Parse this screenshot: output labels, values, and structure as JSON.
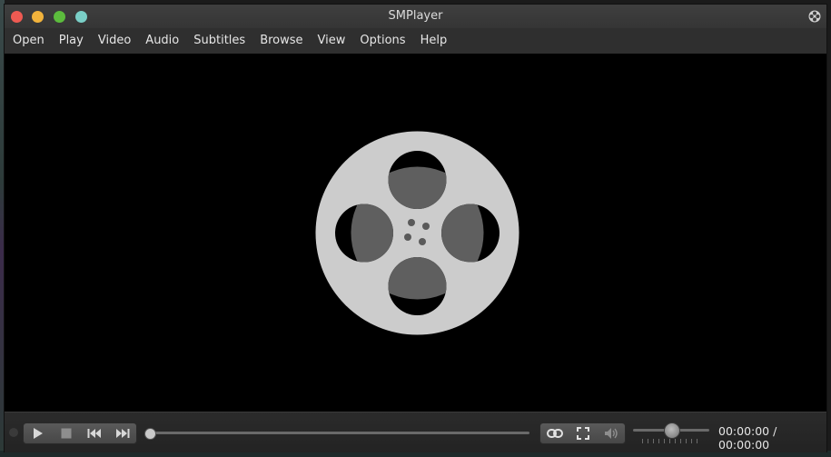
{
  "window": {
    "title": "SMPlayer"
  },
  "menu": {
    "items": [
      "Open",
      "Play",
      "Video",
      "Audio",
      "Subtitles",
      "Browse",
      "View",
      "Options",
      "Help"
    ]
  },
  "titlebar_buttons": [
    "close",
    "minimize",
    "maximize",
    "extra"
  ],
  "video": {
    "placeholder_icon": "film-reel-icon"
  },
  "controls": {
    "left_buttons": [
      "play-icon",
      "stop-icon",
      "previous-icon",
      "next-icon"
    ],
    "right_buttons": [
      "link-icon",
      "fullscreen-icon",
      "volume-icon"
    ],
    "seek_fraction": 0.0,
    "volume_fraction": 0.5,
    "time_display": "00:00:00 / 00:00:00"
  },
  "colors": {
    "titlebar": "#3a3a3a",
    "menubar": "#2f2f2f",
    "video_bg": "#000000",
    "reel": "#cccccc",
    "reel_hub": "#5a5a5a",
    "close": "#ee5a52",
    "minimize": "#f2b33c",
    "maximize": "#5cbc3d",
    "extra": "#7acfc7"
  }
}
